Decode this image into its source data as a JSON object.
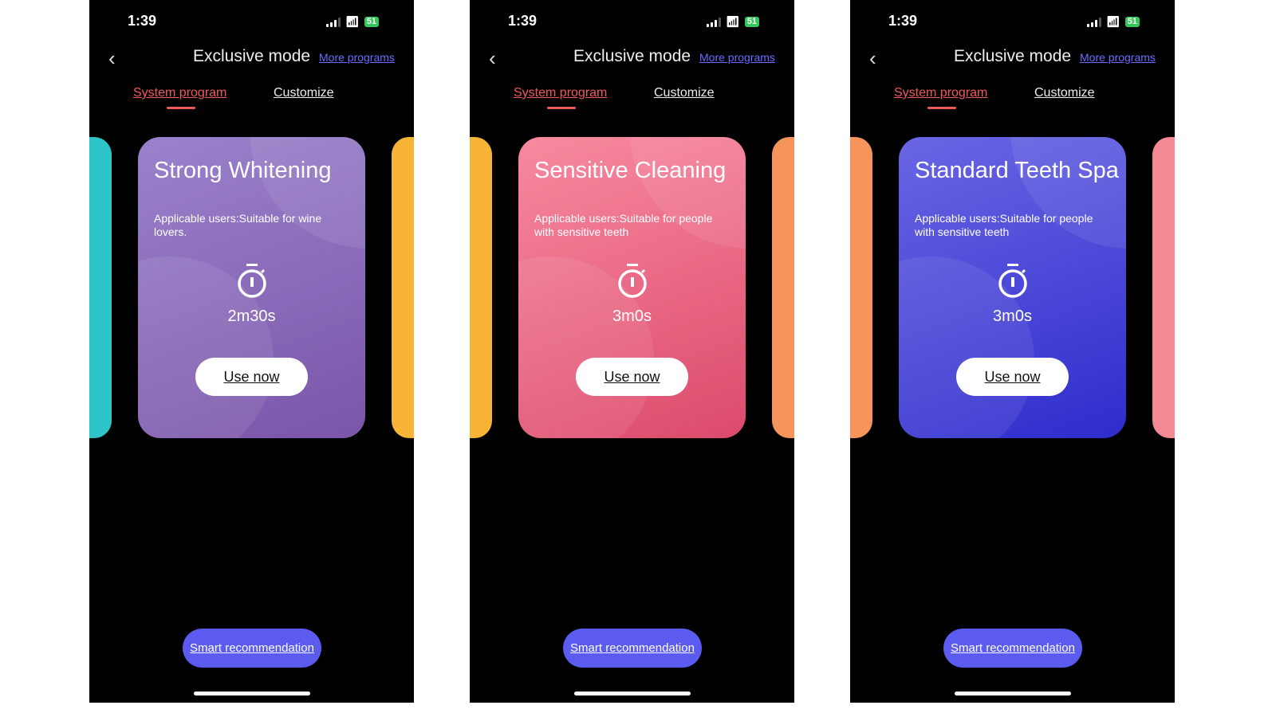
{
  "status": {
    "time": "1:39",
    "battery": "51"
  },
  "header": {
    "title": "Exclusive mode",
    "more_programs": "More programs"
  },
  "tabs": [
    {
      "label": "System program",
      "active": true
    },
    {
      "label": "Customize",
      "active": false
    }
  ],
  "screens": [
    {
      "card": {
        "title": "Strong Whitening",
        "desc": "Applicable users:Suitable for wine lovers.",
        "duration": "2m30s",
        "use_label": "Use now",
        "gradient": [
          "#9a82cc",
          "#7b55a8"
        ]
      },
      "peek_left": "#2cc4c6",
      "peek_right": "#f7b436"
    },
    {
      "card": {
        "title": "Sensitive Cleaning",
        "desc": "Applicable users:Suitable for people with sensitive teeth",
        "duration": "3m0s",
        "use_label": "Use now",
        "gradient": [
          "#f88aa0",
          "#dc4a6c"
        ]
      },
      "peek_left": "#f7b436",
      "peek_right": "#f5955c"
    },
    {
      "card": {
        "title": "Standard Teeth Spa",
        "desc": "Applicable users:Suitable for people with sensitive teeth",
        "duration": "3m0s",
        "use_label": "Use now",
        "gradient": [
          "#6a66e4",
          "#2e2ccc"
        ]
      },
      "peek_left": "#f5955c",
      "peek_right": "#f38a94"
    }
  ],
  "smart_recommendation": "Smart recommendation",
  "colors": {
    "accent": "#f05a5a",
    "link": "#6b6bff",
    "button": "#5b5bf0"
  }
}
